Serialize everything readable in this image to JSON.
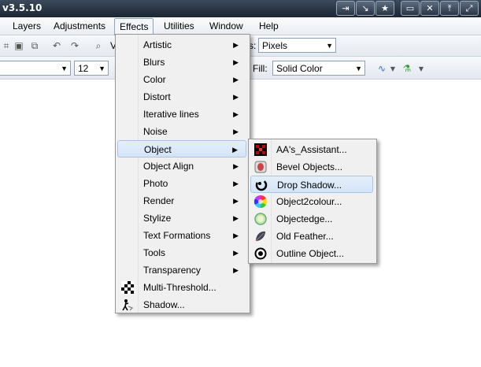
{
  "app": {
    "title": "v3.5.10"
  },
  "window_buttons": [
    "⇥",
    "↘",
    "★",
    "▭",
    "✕",
    "⤒",
    "⤢"
  ],
  "menubar": {
    "items": [
      "Layers",
      "Adjustments",
      "Effects",
      "Utilities",
      "Window",
      "Help"
    ],
    "active": "Effects"
  },
  "toolbar1": {
    "units_label": "s:",
    "units_value": "Pixels",
    "zoom_partial": "V"
  },
  "toolbar2": {
    "font_size": "12",
    "fill_label": "Fill:",
    "fill_value": "Solid Color"
  },
  "effects_menu": {
    "items": [
      {
        "label": "Artistic",
        "submenu": true
      },
      {
        "label": "Blurs",
        "submenu": true
      },
      {
        "label": "Color",
        "submenu": true
      },
      {
        "label": "Distort",
        "submenu": true
      },
      {
        "label": "Iterative lines",
        "submenu": true
      },
      {
        "label": "Noise",
        "submenu": true
      },
      {
        "label": "Object",
        "submenu": true,
        "selected": true
      },
      {
        "label": "Object Align",
        "submenu": true
      },
      {
        "label": "Photo",
        "submenu": true
      },
      {
        "label": "Render",
        "submenu": true
      },
      {
        "label": "Stylize",
        "submenu": true
      },
      {
        "label": "Text Formations",
        "submenu": true
      },
      {
        "label": "Tools",
        "submenu": true
      },
      {
        "label": "Transparency",
        "submenu": true
      },
      {
        "label": "Multi-Threshold...",
        "submenu": false,
        "icon": "checker-icon"
      },
      {
        "label": "Shadow...",
        "submenu": false,
        "icon": "shadow-figure-icon"
      }
    ]
  },
  "object_submenu": {
    "items": [
      {
        "label": "AA's_Assistant...",
        "icon": "aa-assistant-icon"
      },
      {
        "label": "Bevel Objects...",
        "icon": "bevel-icon"
      },
      {
        "label": "Drop Shadow...",
        "icon": "drop-shadow-icon",
        "highlighted": true
      },
      {
        "label": "Object2colour...",
        "icon": "color-wheel-icon"
      },
      {
        "label": "Objectedge...",
        "icon": "edge-circle-icon"
      },
      {
        "label": "Old Feather...",
        "icon": "feather-icon"
      },
      {
        "label": "Outline Object...",
        "icon": "outline-target-icon"
      }
    ]
  },
  "colors": {
    "highlight": "#d3e4f8",
    "menu_bg": "#f0f0f0",
    "titlebar": "#1c2633"
  }
}
